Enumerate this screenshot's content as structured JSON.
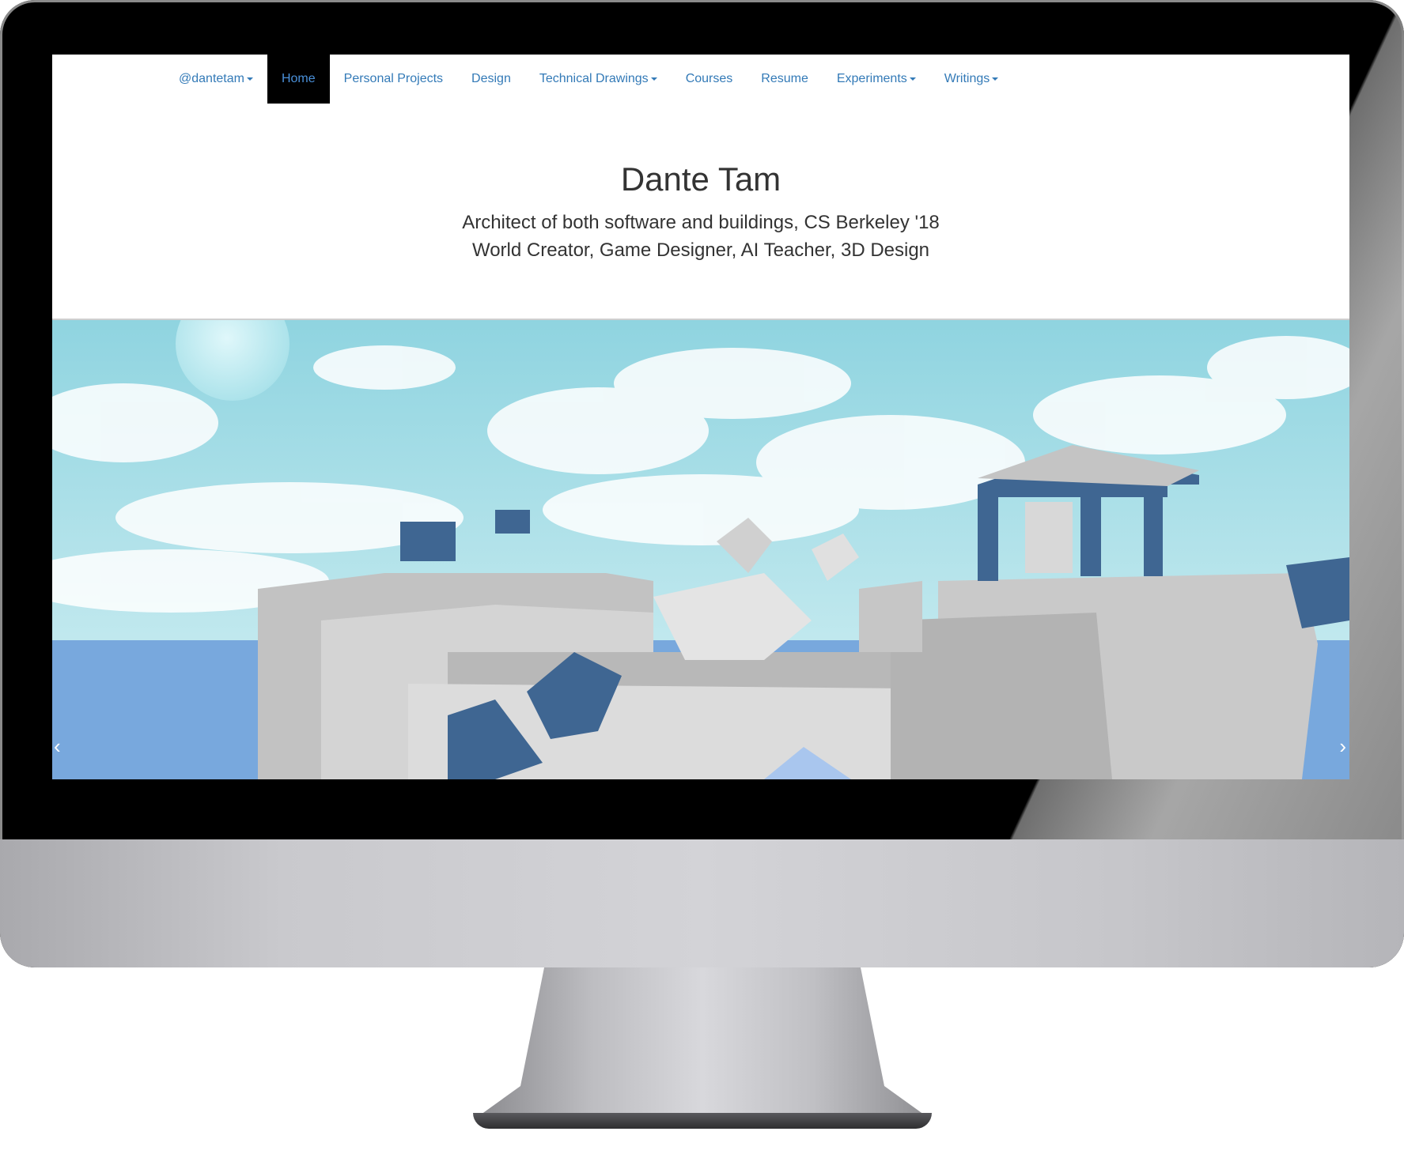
{
  "nav": {
    "items": [
      {
        "label": "@dantetam",
        "dropdown": true,
        "active": false
      },
      {
        "label": "Home",
        "dropdown": false,
        "active": true
      },
      {
        "label": "Personal Projects",
        "dropdown": false,
        "active": false
      },
      {
        "label": "Design",
        "dropdown": false,
        "active": false
      },
      {
        "label": "Technical Drawings",
        "dropdown": true,
        "active": false
      },
      {
        "label": "Courses",
        "dropdown": false,
        "active": false
      },
      {
        "label": "Resume",
        "dropdown": false,
        "active": false
      },
      {
        "label": "Experiments",
        "dropdown": true,
        "active": false
      },
      {
        "label": "Writings",
        "dropdown": true,
        "active": false
      }
    ]
  },
  "header": {
    "title": "Dante Tam",
    "subtitle_line1": "Architect of both software and buildings, CS Berkeley '18",
    "subtitle_line2": "World Creator, Game Designer, AI Teacher, 3D Design"
  },
  "carousel": {
    "prev_glyph": "‹",
    "next_glyph": "›",
    "prev_icon": "chevron-left-icon",
    "next_icon": "chevron-right-icon"
  },
  "colors": {
    "link": "#337ab7",
    "active_nav_bg": "#000000",
    "sky": "#9fdbe4",
    "sea": "#78a8dd",
    "block_blue": "#3f6692",
    "block_gray": "#c8c8c8"
  }
}
